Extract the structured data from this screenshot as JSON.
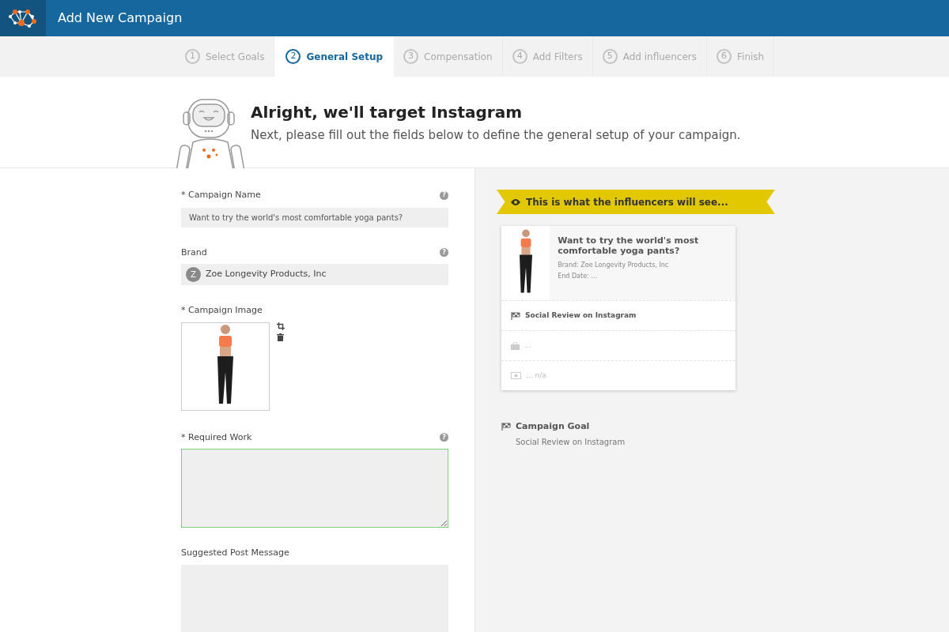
{
  "header": {
    "title": "Add New Campaign"
  },
  "steps": [
    {
      "number": "1",
      "label": "Select Goals",
      "selected": false
    },
    {
      "number": "2",
      "label": "General Setup",
      "selected": true
    },
    {
      "number": "3",
      "label": "Compensation",
      "selected": false
    },
    {
      "number": "4",
      "label": "Add Filters",
      "selected": false
    },
    {
      "number": "5",
      "label": "Add influencers",
      "selected": false
    },
    {
      "number": "6",
      "label": "Finish",
      "selected": false
    }
  ],
  "hero": {
    "title": "Alright, we'll target Instagram",
    "subtitle": "Next, please fill out the fields below to define the general setup of your campaign."
  },
  "form": [
    {
      "kind": "text",
      "label": "* Campaign Name",
      "help": "?",
      "value": "Want to try the world's most comfortable yoga pants?",
      "focused": false
    },
    {
      "kind": "brand",
      "label": "Brand",
      "help": "?",
      "avatar": "Z",
      "value": "Zoe Longevity Products, Inc",
      "focused": false
    },
    {
      "kind": "image",
      "label": "* Campaign Image"
    },
    {
      "kind": "textarea",
      "label": "* Required Work",
      "help": "?",
      "focused": true
    },
    {
      "kind": "textarea",
      "label": "Suggested Post Message",
      "focused": false
    }
  ],
  "preview": {
    "banner": "This is what the influencers will see...",
    "card": {
      "title": "Want to try the world's most comfortable yoga pants?",
      "brand": "Brand: Zoe Longevity Products, Inc",
      "end_date": "End Date: ...",
      "rows": [
        {
          "kind": "goal",
          "text": "Social Review on Instagram",
          "disabled": false
        },
        {
          "kind": "product",
          "text": "...",
          "disabled": true
        },
        {
          "kind": "money",
          "text": "... n/a",
          "disabled": true
        }
      ]
    },
    "goal": {
      "title": "Campaign Goal",
      "value": "Social Review on Instagram"
    }
  }
}
